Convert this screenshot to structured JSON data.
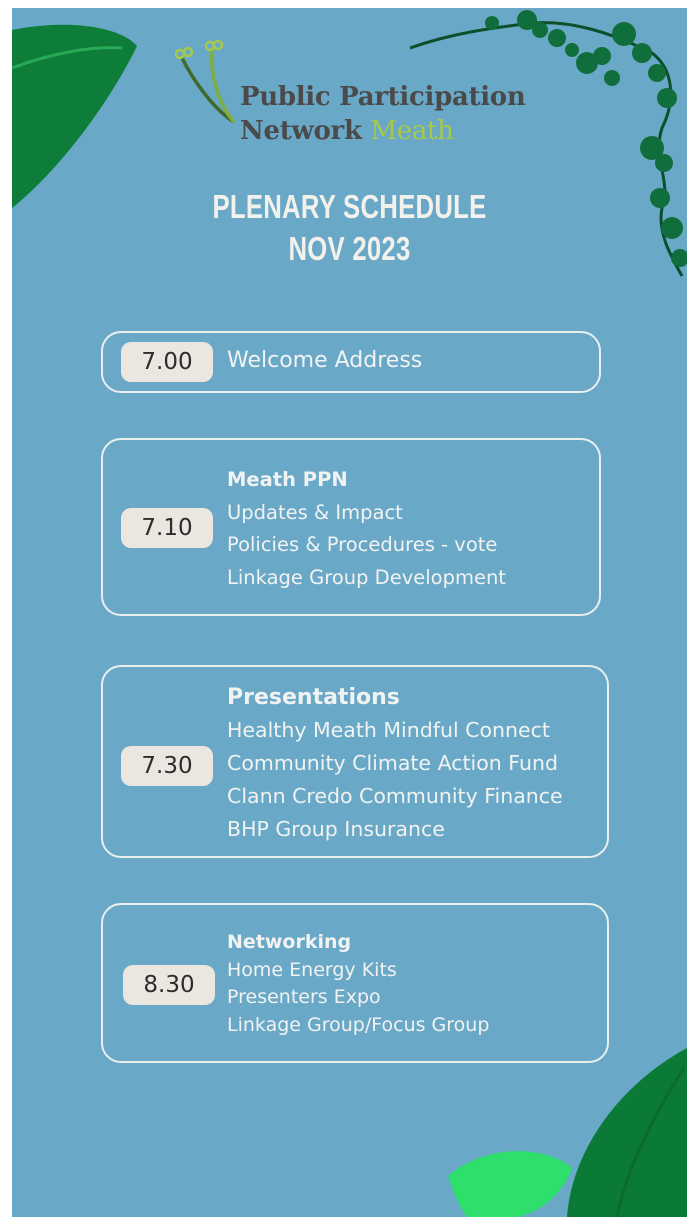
{
  "logo": {
    "line1": "Public Participation",
    "line2_main": "Network",
    "line2_accent": "Meath"
  },
  "heading": {
    "line1": "PLENARY SCHEDULE",
    "line2": "NOV 2023"
  },
  "colors": {
    "background": "#6aa8c7",
    "leaf_dark": "#0d7a39",
    "leaf_light": "#2ee06b",
    "pill": "#ebe7e0",
    "logo_accent": "#a6c94c"
  },
  "schedule": [
    {
      "time": "7.00",
      "title": "",
      "items": [
        "Welcome Address"
      ]
    },
    {
      "time": "7.10",
      "title": "Meath PPN",
      "items": [
        "Updates & Impact",
        "Policies & Procedures - vote",
        "Linkage Group Development"
      ]
    },
    {
      "time": "7.30",
      "title": "Presentations",
      "items": [
        "Healthy Meath Mindful Connect",
        "Community Climate Action Fund",
        "Clann Credo Community Finance",
        "BHP Group Insurance"
      ]
    },
    {
      "time": "8.30",
      "title": "Networking",
      "items": [
        "Home Energy Kits",
        "Presenters Expo",
        "Linkage Group/Focus Group"
      ]
    }
  ]
}
